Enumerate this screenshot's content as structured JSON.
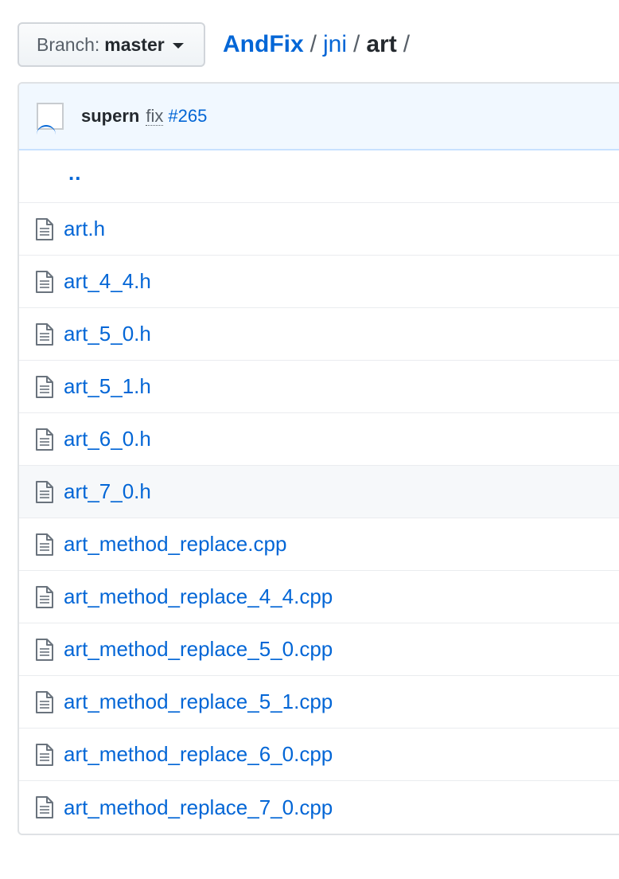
{
  "branch": {
    "prefix": "Branch:",
    "name": "master"
  },
  "breadcrumb": {
    "root": "AndFix",
    "separator": "/",
    "parent": "jni",
    "current": "art"
  },
  "commit": {
    "author": "supern",
    "message": "fix",
    "issue": "#265"
  },
  "up_directory": "..",
  "files": [
    {
      "name": "art.h",
      "icon": "file-text-icon"
    },
    {
      "name": "art_4_4.h",
      "icon": "file-text-icon"
    },
    {
      "name": "art_5_0.h",
      "icon": "file-text-icon"
    },
    {
      "name": "art_5_1.h",
      "icon": "file-text-icon"
    },
    {
      "name": "art_6_0.h",
      "icon": "file-text-icon"
    },
    {
      "name": "art_7_0.h",
      "icon": "file-text-icon"
    },
    {
      "name": "art_method_replace.cpp",
      "icon": "file-text-icon"
    },
    {
      "name": "art_method_replace_4_4.cpp",
      "icon": "file-text-icon"
    },
    {
      "name": "art_method_replace_5_0.cpp",
      "icon": "file-text-icon"
    },
    {
      "name": "art_method_replace_5_1.cpp",
      "icon": "file-text-icon"
    },
    {
      "name": "art_method_replace_6_0.cpp",
      "icon": "file-text-icon"
    },
    {
      "name": "art_method_replace_7_0.cpp",
      "icon": "file-text-icon"
    }
  ],
  "colors": {
    "link": "#0366d6",
    "commit_bar_bg": "#f1f8ff",
    "row_hover_bg": "#f6f8fa"
  }
}
